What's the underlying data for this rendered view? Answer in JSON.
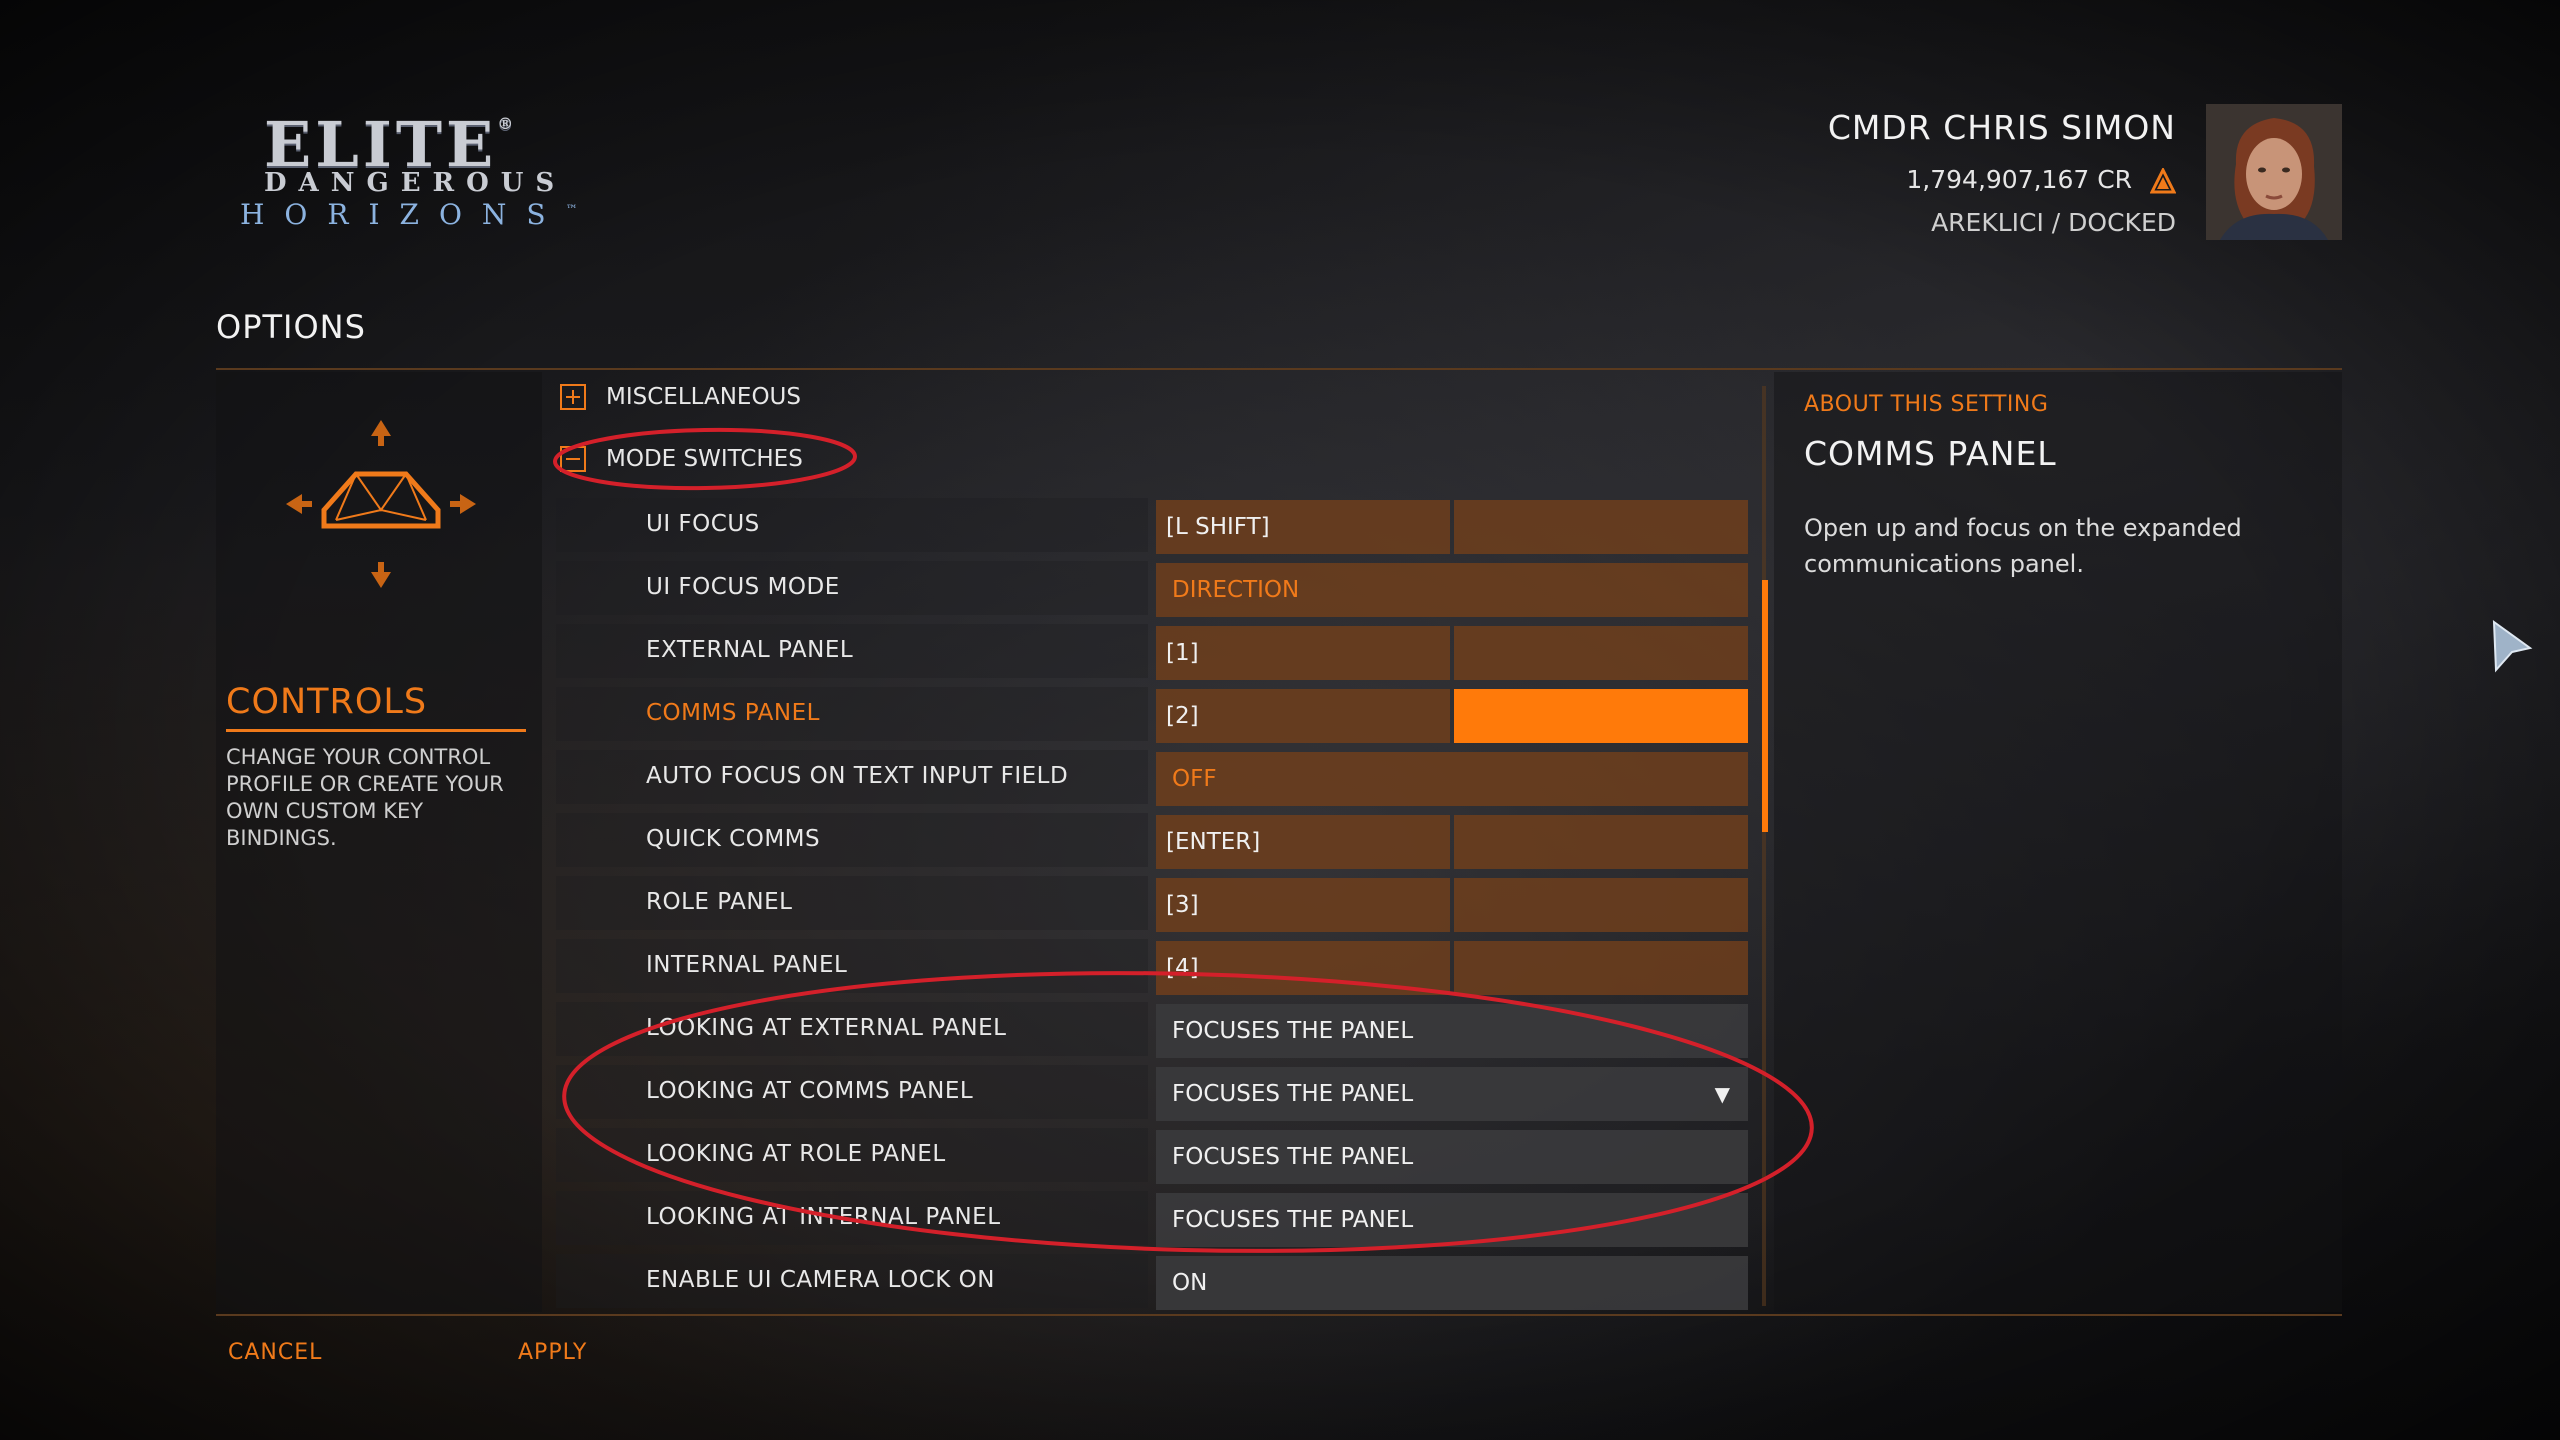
{
  "logo": {
    "line1": "ELITE",
    "reg": "®",
    "line2": "DANGEROUS",
    "line3": "HORIZONS",
    "tm": "™"
  },
  "commander": {
    "name": "CMDR CHRIS SIMON",
    "credits": "1,794,907,167 CR",
    "location": "AREKLICI / DOCKED"
  },
  "page_title": "OPTIONS",
  "left_panel": {
    "title": "CONTROLS",
    "description": "CHANGE YOUR CONTROL PROFILE OR CREATE YOUR OWN CUSTOM KEY BINDINGS."
  },
  "sections": [
    {
      "label": "MISCELLANEOUS",
      "state": "collapsed"
    },
    {
      "label": "MODE SWITCHES",
      "state": "expanded"
    }
  ],
  "rows": [
    {
      "label": "UI FOCUS",
      "primary": "[L SHIFT]",
      "secondary": ""
    },
    {
      "label": "UI FOCUS MODE",
      "value": "DIRECTION"
    },
    {
      "label": "EXTERNAL PANEL",
      "primary": "[1]",
      "secondary": ""
    },
    {
      "label": "COMMS PANEL",
      "primary": "[2]",
      "secondary": "",
      "selected": true
    },
    {
      "label": "AUTO FOCUS ON TEXT INPUT FIELD",
      "value": "OFF"
    },
    {
      "label": "QUICK COMMS",
      "primary": "[ENTER]",
      "secondary": ""
    },
    {
      "label": "ROLE PANEL",
      "primary": "[3]",
      "secondary": ""
    },
    {
      "label": "INTERNAL PANEL",
      "primary": "[4]",
      "secondary": ""
    },
    {
      "label": "LOOKING AT EXTERNAL PANEL",
      "option": "FOCUSES THE PANEL"
    },
    {
      "label": "LOOKING AT COMMS PANEL",
      "option": "FOCUSES THE PANEL"
    },
    {
      "label": "LOOKING AT ROLE PANEL",
      "option": "FOCUSES THE PANEL"
    },
    {
      "label": "LOOKING AT INTERNAL PANEL",
      "option": "FOCUSES THE PANEL"
    },
    {
      "label": "ENABLE UI CAMERA LOCK ON",
      "option": "ON"
    }
  ],
  "about": {
    "heading": "ABOUT THIS SETTING",
    "title": "COMMS PANEL",
    "description": "Open up and focus on the expanded communications panel."
  },
  "footer": {
    "cancel": "CANCEL",
    "apply": "APPLY"
  },
  "colors": {
    "accent": "#f07a1a",
    "key_cell": "#6e3e1c",
    "active_cell": "#ff7a0a",
    "option_cell": "#3a3a3c",
    "annotation": "#d4202a"
  },
  "icons": {
    "credit": "credit-triangle-icon",
    "plus": "plus-box-icon",
    "minus": "minus-box-icon",
    "dropdown": "dropdown-caret-icon",
    "nav": "nav-arrows-icon",
    "cursor": "pointer-cursor-icon"
  }
}
